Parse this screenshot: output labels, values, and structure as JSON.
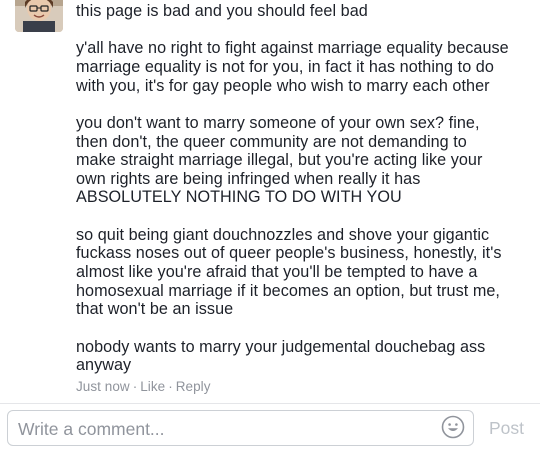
{
  "comment": {
    "author_avatar": "avatar-photo",
    "title": "this page is bad and you should feel bad",
    "paragraphs": [
      "y'all have no right to fight against marriage equality because\nmarriage equality is not for you, in fact it has nothing to do\nwith you, it's for gay people who wish to marry each other",
      "you don't want to marry someone of your own sex? fine,\nthen don't, the queer community are not demanding to\nmake straight marriage illegal, but you're acting like your\nown rights are being infringed when really it has\nABSOLUTELY NOTHING TO DO WITH YOU",
      "so quit being giant douchnozzles and shove your gigantic\nfuckass noses out of queer people's business, honestly, it's\nalmost like you're afraid that you'll be tempted to have a\nhomosexual marriage if it becomes an option, but trust me,\nthat won't be an issue",
      "nobody wants to marry your judgemental douchebag ass\nanyway"
    ],
    "timestamp": "Just now",
    "separator": "·",
    "like_label": "Like",
    "reply_label": "Reply"
  },
  "composer": {
    "placeholder": "Write a comment...",
    "emoji_icon": "smiley-icon",
    "post_label": "Post"
  },
  "colors": {
    "text": "#1d2129",
    "meta": "#90949c",
    "post_disabled": "#bec3c9",
    "input_border": "#ccd0d5"
  }
}
